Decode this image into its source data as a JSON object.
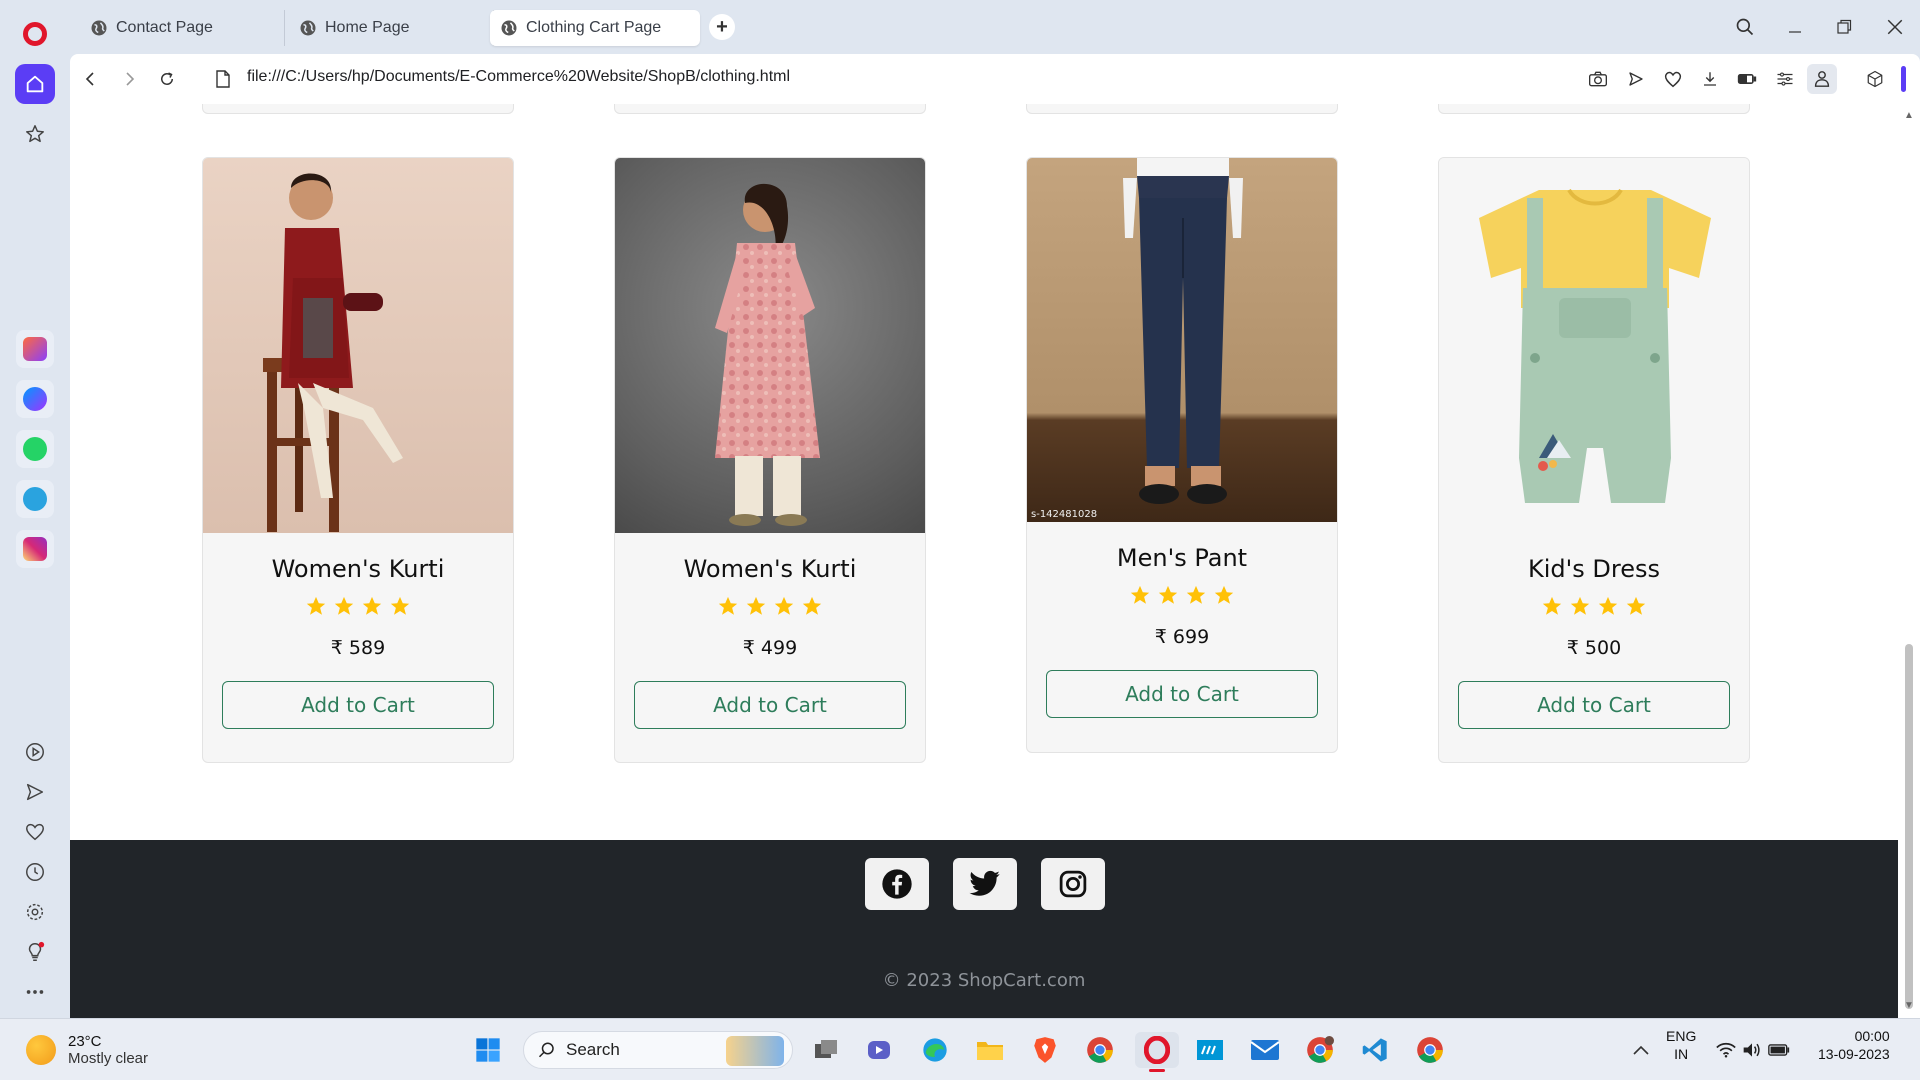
{
  "browser": {
    "tabs": [
      {
        "label": "Contact Page"
      },
      {
        "label": "Home Page"
      },
      {
        "label": "Clothing Cart Page"
      }
    ],
    "url": "file:///C:/Users/hp/Documents/E-Commerce%20Website/ShopB/clothing.html"
  },
  "products": [
    {
      "title": "Women's Kurti",
      "price": "₹ 589",
      "button": "Add to Cart",
      "rating": 4,
      "image_icon": "red-kurti-photo"
    },
    {
      "title": "Women's Kurti",
      "price": "₹ 499",
      "button": "Add to Cart",
      "rating": 4,
      "image_icon": "pink-kurti-photo"
    },
    {
      "title": "Men's Pant",
      "price": "₹ 699",
      "button": "Add to Cart",
      "rating": 4,
      "image_icon": "navy-pant-photo",
      "image_caption": "s-142481028"
    },
    {
      "title": "Kid's Dress",
      "price": "₹ 500",
      "button": "Add to Cart",
      "rating": 4,
      "image_icon": "kids-dungaree-photo"
    }
  ],
  "footer": {
    "social": [
      "facebook-icon",
      "twitter-icon",
      "instagram-icon"
    ],
    "copyright": "© 2023 ShopCart.com"
  },
  "taskbar": {
    "weather_temp": "23°C",
    "weather_cond": "Mostly clear",
    "search_label": "Search",
    "lang_top": "ENG",
    "lang_bottom": "IN",
    "time": "00:00",
    "date": "13-09-2023"
  },
  "colors": {
    "accent_green": "#2e7d5b",
    "star": "#ffc107",
    "footer_bg": "#212529",
    "opera_red": "#e0162b",
    "opera_purple": "#5b3df5"
  }
}
